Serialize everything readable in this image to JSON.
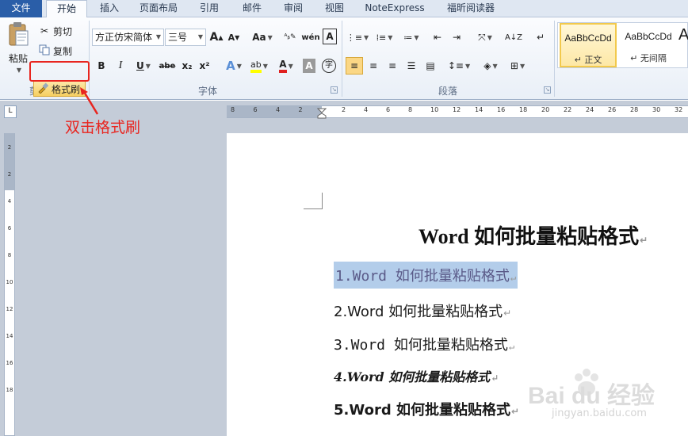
{
  "tabs": {
    "file": "文件",
    "home": "开始",
    "insert": "插入",
    "layout": "页面布局",
    "references": "引用",
    "mailings": "邮件",
    "review": "审阅",
    "view": "视图",
    "noteexpress": "NoteExpress",
    "foxit": "福昕阅读器"
  },
  "clipboard": {
    "paste": "粘贴",
    "cut": "剪切",
    "copy": "复制",
    "format_painter": "格式刷",
    "group_label": "剪贴板"
  },
  "font": {
    "family": "方正仿宋简体",
    "size": "三号",
    "group_label": "字体",
    "grow": "A",
    "shrink": "A",
    "case": "Aa",
    "bold": "B",
    "italic": "I",
    "underline": "U",
    "strike": "abe",
    "sub": "x₂",
    "sup": "x²",
    "wen": "wén",
    "border_a": "A",
    "char_shade": "A",
    "circle_char": "字"
  },
  "paragraph": {
    "group_label": "段落"
  },
  "styles": {
    "items": [
      {
        "sample": "AaBbCcDd",
        "name": "↵ 正文"
      },
      {
        "sample": "AaBbCcDd",
        "name": "↵ 无间隔"
      },
      {
        "sample": "A",
        "name": ""
      }
    ]
  },
  "ruler": {
    "tab_glyph": "L",
    "h_numbers": [
      "8",
      "6",
      "4",
      "2",
      "2",
      "4",
      "6",
      "8",
      "10",
      "12",
      "14",
      "16",
      "18",
      "20",
      "22",
      "24",
      "26",
      "28",
      "30",
      "32"
    ],
    "v_numbers": [
      "2",
      "2",
      "4",
      "6",
      "8",
      "10",
      "12",
      "14",
      "16",
      "18"
    ]
  },
  "document": {
    "title": "Word 如何批量粘贴格式",
    "lines": [
      "1.Word 如何批量粘贴格式",
      "2.Word 如何批量粘贴格式",
      "3.Word 如何批量粘贴格式",
      "4.Word 如何批量粘贴格式",
      "5.Word 如何批量粘贴格式"
    ],
    "para_mark": "↵"
  },
  "annotation": "双击格式刷",
  "watermark": {
    "brand": "Bai du 经验",
    "url": "jingyan.baidu.com"
  },
  "colors": {
    "accent_red": "#e8251f",
    "selection": "#b3cdea",
    "file_tab": "#2a5ea8"
  }
}
